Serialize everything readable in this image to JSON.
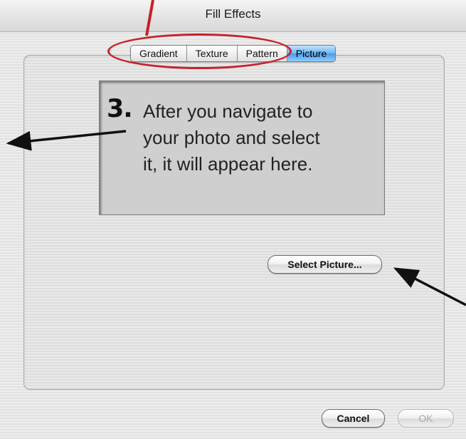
{
  "window": {
    "title": "Fill Effects"
  },
  "tabs": [
    {
      "label": "Gradient",
      "selected": false
    },
    {
      "label": "Texture",
      "selected": false
    },
    {
      "label": "Pattern",
      "selected": false
    },
    {
      "label": "Picture",
      "selected": true
    }
  ],
  "annotation": {
    "number": "3.",
    "lines": [
      "After you navigate to",
      "your photo and select",
      "it, it will appear here."
    ],
    "accent_color": "#c8202a"
  },
  "buttons": {
    "select_picture": "Select Picture...",
    "cancel": "Cancel",
    "ok": "OK"
  }
}
